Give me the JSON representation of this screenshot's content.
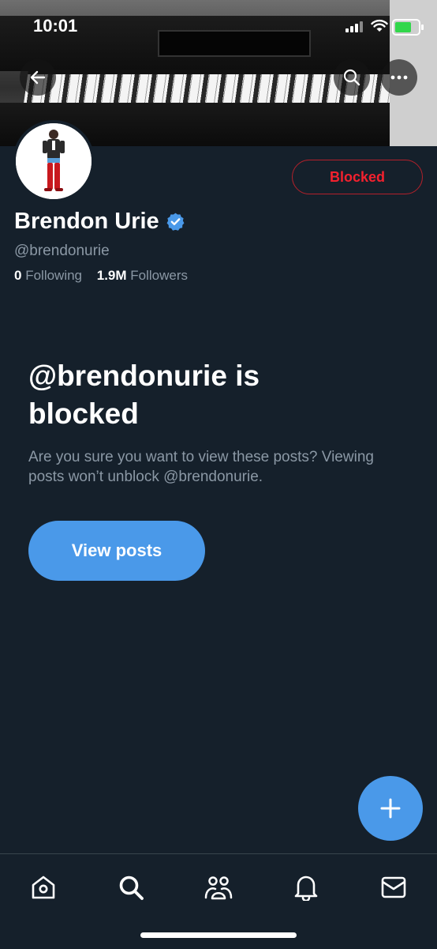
{
  "status_bar": {
    "time": "10:01"
  },
  "profile": {
    "name": "Brendon Urie",
    "handle": "@brendonurie",
    "following_count": "0",
    "following_label": "Following",
    "followers_count": "1.9M",
    "followers_label": "Followers",
    "blocked_button_label": "Blocked"
  },
  "blocked_notice": {
    "headline": "@brendonurie is blocked",
    "description": "Are you sure you want to view these posts? Viewing posts won’t unblock @brendonurie.",
    "view_posts_label": "View posts"
  },
  "icons": {
    "back": "arrow-left-icon",
    "search": "search-icon",
    "more": "more-horizontal-icon",
    "verified": "verified-badge-icon",
    "compose": "plus-icon",
    "tabs": [
      "home-icon",
      "search-icon",
      "communities-icon",
      "bell-icon",
      "mail-icon"
    ]
  },
  "colors": {
    "background": "#15202b",
    "accent": "#4a99e9",
    "blocked_red": "#f4212e",
    "secondary_text": "#8b98a5"
  }
}
